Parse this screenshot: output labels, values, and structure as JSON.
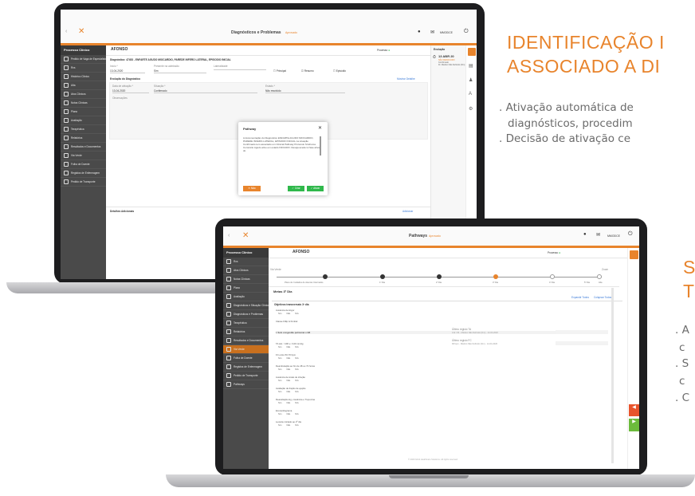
{
  "marketing": {
    "title1_line1": "IDENTIFICAÇÃO I",
    "title1_line2": "ASSOCIADO A DI",
    "bullet1a": ". Ativação automática de",
    "bullet1b": "diagnósticos, procedim",
    "bullet1c": ". Decisão de ativação ce",
    "title2_line1": "S",
    "title2_line2": "T",
    "b2a": ". A",
    "b2b": "c",
    "b2c": ". S",
    "b2d": "c",
    "b2e": ". C"
  },
  "laptop1": {
    "header_title": "Diagnósticos e Problemas",
    "header_sub": "Aprovado",
    "user": "MMODCE",
    "patient": "AFONSO",
    "status": "Processo",
    "sidebar_header": "Processo Clínico",
    "sidebar_items": [
      "Pedido de Vaga de Especialista",
      "Rxs",
      "Histórico Clínico",
      "Alta",
      "Atos Clínicos",
      "Notas Clínicas",
      "Plano",
      "Avaliação",
      "Terapêutica",
      "Relatórios",
      "Resultados e Documentos",
      "Via Verde",
      "Folha de Doente",
      "Registos de Enfermagem",
      "Pedido de Transporte"
    ],
    "diag_title": "Diagnóstico: 47453 - ENFARTE AGUDO MIOCARDIO, PAREDE INFERO LATERAL, EPISODIO INICIAL",
    "labels": {
      "inicio": "Início *",
      "presente": "Presente na admissão",
      "lateralidade": "Lateralidade",
      "principal": "Principal",
      "resumo": "Resumo",
      "episodio": "Episódio",
      "evolucao_diag": "Evolução do Diagnóstico",
      "mostrar": "Mostrar Detalhe",
      "data_ativ": "Data de ativação *",
      "situacao": "Situação *",
      "estado": "Estado *",
      "observacoes": "Observações",
      "detalhes": "Detalhes Adicionais",
      "adicionar": "Adicionar"
    },
    "values": {
      "inicio": "13-04-2020",
      "presente": "Sim",
      "data_ativ": "13-04-2020",
      "situacao": "Confirmado",
      "estado": "Não resolvido"
    },
    "evolucao": {
      "title": "Evolução",
      "date": "13 ABR 20",
      "line1": "NÃO RESOLVIDO",
      "line2": "Confirmado",
      "line3": "Dr. Médico Não Definido (Dm)"
    },
    "modal": {
      "title": "Pathway",
      "body": "A documentação do Diagnóstico ENFARTE AGUDO MIOCARDIO, PAREDE INFERO-LATERAL, EPISODIO INICIAL na situação Confirmado tem associado um Clinical Pathway Protocolo Síndroma Coronário Agudo ativo em estado INICIADO. Deseja aceder à fase ativa do",
      "no": "Não",
      "yes1": "Criar",
      "yes2": "Ativar"
    }
  },
  "laptop2": {
    "header_title": "Pathways",
    "header_sub": "Aprovado",
    "user": "MMODCE",
    "patient": "AFONSO",
    "status": "Processo",
    "sidebar_header": "Processo Clínico",
    "sidebar_items": [
      "Rxs",
      "Atos Clínicos",
      "Notas Clínicas",
      "Plano",
      "Avaliação",
      "Diagnósticos e Situação Clínica",
      "Diagnósticos e Problemas",
      "Terapêutica",
      "Relatórios",
      "Resultados e Documentos",
      "Via Verde",
      "Folha de Doente",
      "Registos de Enfermagem",
      "Pedido de Transporte",
      "Pathways"
    ],
    "via_label": "Via Verde",
    "timeline_left": "Plano de Cuidados de doentes Internados",
    "timeline_steps": [
      "1º Dia",
      "2º Dia",
      "3º Dia",
      "4º Dia",
      "5º Dia",
      "Alta"
    ],
    "zoom": "Zoom",
    "metas": "Metas 3º Dia",
    "objectives": "Objetivos transversais 3º dia",
    "expand": "Expandir Todos",
    "collapse": "Colapsar Todos",
    "items": [
      "Ausência de ângor",
      "Classe Killip & Kimbal",
      "I. Sem congestão pulmonar e B3",
      "TA sist. >100 e <140 mmHg",
      "FC entre 50-70 bpm",
      "Deambulação ao fim de 48 ou 72 horas",
      "Ausência de sinais de infeção",
      "Avaliação da fração de ejeção",
      "Reavaliação Hg, creatinina e Troponina",
      "Ecocardiograma",
      "Levante iniciado ao 2º dia"
    ],
    "opt_sim": "Sim",
    "opt_nao": "Não",
    "opt_na": "N/A",
    "reg_ta": "Último registo TA",
    "reg_fc": "Último registo FC",
    "reg_ta_val": "132 / 84 - Médico Não Definido (Dm) - 14-04-2020",
    "reg_fc_val": "68 bpm - Médico Não Definido (Dm) - 14-04-2020",
    "footer": "© 2020 Glintt Healthcare Solutions. All rights reserved.",
    "side_btn1": "Anterior",
    "side_btn2": "Seguinte"
  }
}
